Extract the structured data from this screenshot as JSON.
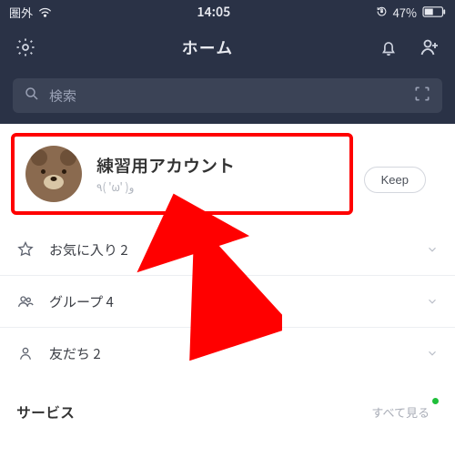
{
  "status": {
    "carrier": "圏外",
    "time": "14:05",
    "battery_pct": "47%"
  },
  "nav": {
    "title": "ホーム"
  },
  "search": {
    "placeholder": "検索"
  },
  "profile": {
    "name": "練習用アカウント",
    "status_msg": "٩( 'ω' )و",
    "keep_label": "Keep"
  },
  "rows": [
    {
      "icon": "star",
      "label": "お気に入り 2"
    },
    {
      "icon": "group",
      "label": "グループ 4"
    },
    {
      "icon": "friend",
      "label": "友だち 2"
    }
  ],
  "service": {
    "title": "サービス",
    "see_all": "すべて見る"
  }
}
